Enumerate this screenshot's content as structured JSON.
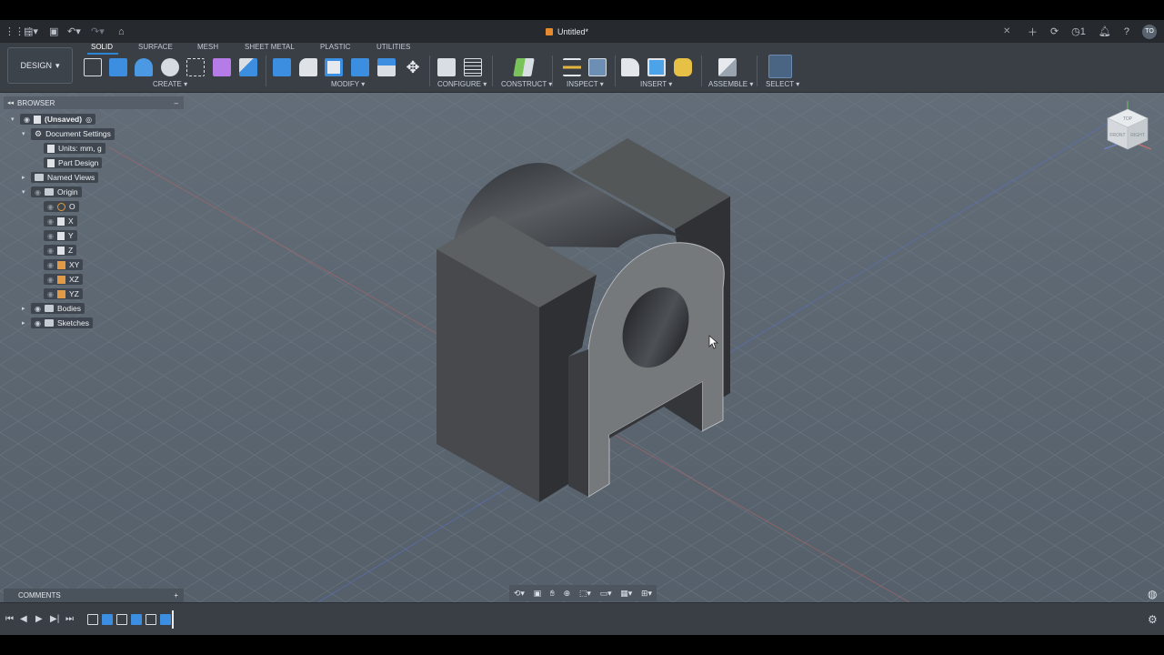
{
  "titlebar": {
    "doc_title": "Untitled*",
    "notification_count": "1",
    "user_initials": "TO"
  },
  "toolbar": {
    "workspace": "DESIGN",
    "tabs": [
      "SOLID",
      "SURFACE",
      "MESH",
      "SHEET METAL",
      "PLASTIC",
      "UTILITIES"
    ],
    "active_tab": "SOLID",
    "groups": {
      "create": "CREATE",
      "modify": "MODIFY",
      "configure": "CONFIGURE",
      "construct": "CONSTRUCT",
      "inspect": "INSPECT",
      "insert": "INSERT",
      "assemble": "ASSEMBLE",
      "select": "SELECT"
    }
  },
  "browser": {
    "title": "BROWSER",
    "root": "(Unsaved)",
    "document_settings": "Document Settings",
    "units": "Units: mm, g",
    "part_design": "Part Design",
    "named_views": "Named Views",
    "origin": "Origin",
    "origin_items": [
      "O",
      "X",
      "Y",
      "Z",
      "XY",
      "XZ",
      "YZ"
    ],
    "bodies": "Bodies",
    "sketches": "Sketches"
  },
  "comments": {
    "title": "COMMENTS"
  },
  "viewcube": {
    "faces": [
      "TOP",
      "FRONT",
      "RIGHT"
    ]
  },
  "colors": {
    "accent": "#2c86d6",
    "viewport": "#5b6570",
    "toolbar": "#3a3f46",
    "origin_orange": "#e39a46"
  }
}
